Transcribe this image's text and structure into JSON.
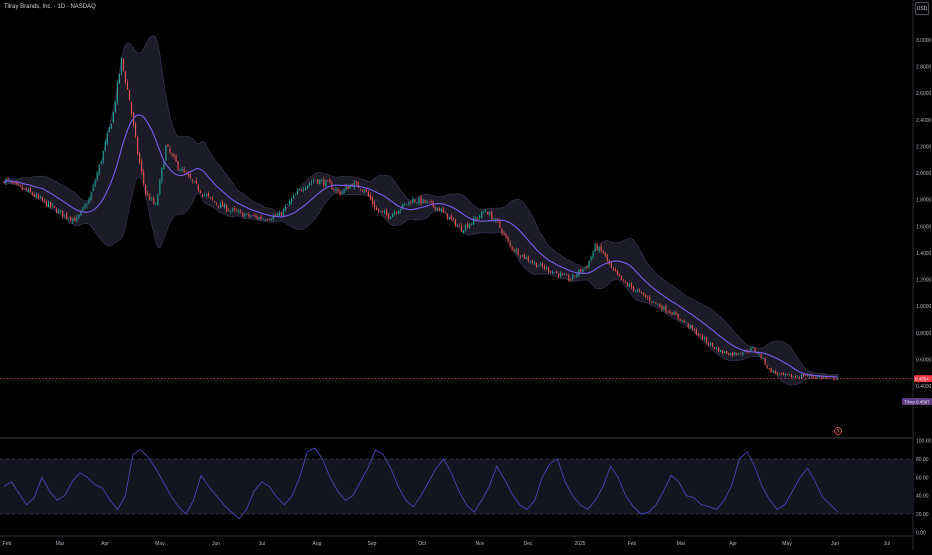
{
  "header": {
    "title": "Tilray Brands, Inc. · 1D · NASDAQ",
    "currency": "USD"
  },
  "colors": {
    "background": "#000000",
    "up": "#26a69a",
    "down": "#ef5350",
    "basis": "#7b5cf0",
    "band_fill": "#1c1c28",
    "rsi_line": "#4a46b8",
    "axis_text": "#b2b5be",
    "price_line": "#f23645"
  },
  "price_axis": {
    "ticks": [
      "3.0000",
      "2.8000",
      "2.6000",
      "2.4000",
      "2.2000",
      "2.0000",
      "1.8000",
      "1.6000",
      "1.4000",
      "1.2000",
      "1.0000",
      "0.8000",
      "0.6000",
      "0.4000"
    ]
  },
  "price_labels": {
    "tag": "Tilray",
    "tag_value": "0.4597",
    "last_value": "0.4554"
  },
  "rsi_axis": {
    "ticks": [
      "100.00",
      "80.00",
      "60.00",
      "40.00",
      "20.00",
      "0.00"
    ]
  },
  "time_axis": {
    "labels": [
      "Feb",
      "Mar",
      "Apr",
      "May",
      "Jun",
      "Jul",
      "Aug",
      "Sep",
      "Oct",
      "Nov",
      "Dec",
      "2025",
      "Feb",
      "Mar",
      "Apr",
      "May",
      "Jun",
      "Jul"
    ]
  },
  "chart_data": {
    "type": "candlestick",
    "symbol": "Tilray Brands, Inc.",
    "interval": "1D",
    "exchange": "NASDAQ",
    "x": [
      "2024-02",
      "2024-03",
      "2024-04",
      "2024-05",
      "2024-06",
      "2024-07",
      "2024-08",
      "2024-09",
      "2024-10",
      "2024-11",
      "2024-12",
      "2025-01",
      "2025-02",
      "2025-03",
      "2025-04",
      "2025-05",
      "2025-06",
      "2025-07"
    ],
    "ylim": [
      0.3,
      3.05
    ],
    "close_trajectory": [
      [
        0,
        1.95
      ],
      [
        6,
        1.9
      ],
      [
        12,
        1.86
      ],
      [
        18,
        1.8
      ],
      [
        24,
        1.74
      ],
      [
        30,
        1.68
      ],
      [
        36,
        1.65
      ],
      [
        42,
        1.8
      ],
      [
        48,
        2.1
      ],
      [
        54,
        2.45
      ],
      [
        58,
        2.85
      ],
      [
        62,
        2.55
      ],
      [
        66,
        2.15
      ],
      [
        70,
        1.85
      ],
      [
        75,
        1.75
      ],
      [
        80,
        2.2
      ],
      [
        86,
        2.05
      ],
      [
        92,
        1.95
      ],
      [
        98,
        1.85
      ],
      [
        104,
        1.78
      ],
      [
        112,
        1.72
      ],
      [
        120,
        1.68
      ],
      [
        128,
        1.66
      ],
      [
        136,
        1.68
      ],
      [
        142,
        1.8
      ],
      [
        148,
        1.9
      ],
      [
        154,
        1.95
      ],
      [
        160,
        1.92
      ],
      [
        166,
        1.85
      ],
      [
        172,
        1.92
      ],
      [
        178,
        1.88
      ],
      [
        184,
        1.72
      ],
      [
        190,
        1.68
      ],
      [
        196,
        1.74
      ],
      [
        202,
        1.8
      ],
      [
        208,
        1.78
      ],
      [
        214,
        1.74
      ],
      [
        220,
        1.66
      ],
      [
        226,
        1.58
      ],
      [
        232,
        1.64
      ],
      [
        238,
        1.72
      ],
      [
        244,
        1.62
      ],
      [
        250,
        1.45
      ],
      [
        256,
        1.38
      ],
      [
        262,
        1.32
      ],
      [
        268,
        1.28
      ],
      [
        274,
        1.24
      ],
      [
        280,
        1.2
      ],
      [
        284,
        1.26
      ],
      [
        288,
        1.3
      ],
      [
        292,
        1.45
      ],
      [
        296,
        1.4
      ],
      [
        300,
        1.28
      ],
      [
        306,
        1.18
      ],
      [
        312,
        1.12
      ],
      [
        318,
        1.06
      ],
      [
        324,
        1.0
      ],
      [
        330,
        0.95
      ],
      [
        336,
        0.88
      ],
      [
        342,
        0.8
      ],
      [
        348,
        0.72
      ],
      [
        354,
        0.66
      ],
      [
        360,
        0.64
      ],
      [
        366,
        0.66
      ],
      [
        370,
        0.68
      ],
      [
        374,
        0.62
      ],
      [
        378,
        0.52
      ],
      [
        384,
        0.48
      ],
      [
        390,
        0.47
      ],
      [
        396,
        0.48
      ],
      [
        402,
        0.47
      ],
      [
        408,
        0.46
      ],
      [
        412,
        0.455
      ]
    ],
    "last_price": 0.4554,
    "indicators": {
      "bollinger": {
        "basis_color": "#7b5cf0",
        "band": "shaded"
      },
      "rsi_like": {
        "ylim": [
          0,
          100
        ],
        "bands": [
          20,
          80
        ],
        "values": [
          50,
          55,
          42,
          30,
          38,
          60,
          45,
          35,
          40,
          55,
          65,
          60,
          52,
          48,
          35,
          25,
          40,
          85,
          90,
          82,
          70,
          55,
          40,
          28,
          20,
          35,
          62,
          50,
          40,
          30,
          22,
          15,
          25,
          45,
          55,
          50,
          38,
          30,
          40,
          60,
          88,
          92,
          80,
          60,
          45,
          35,
          40,
          55,
          70,
          90,
          85,
          70,
          50,
          35,
          28,
          40,
          55,
          70,
          80,
          65,
          45,
          30,
          22,
          35,
          50,
          72,
          58,
          42,
          30,
          25,
          35,
          60,
          75,
          80,
          55,
          40,
          30,
          25,
          35,
          50,
          72,
          60,
          40,
          28,
          20,
          22,
          30,
          45,
          62,
          55,
          40,
          38,
          30,
          28,
          25,
          35,
          52,
          80,
          88,
          72,
          50,
          35,
          25,
          30,
          45,
          60,
          70,
          55,
          38,
          30,
          22
        ]
      }
    }
  }
}
